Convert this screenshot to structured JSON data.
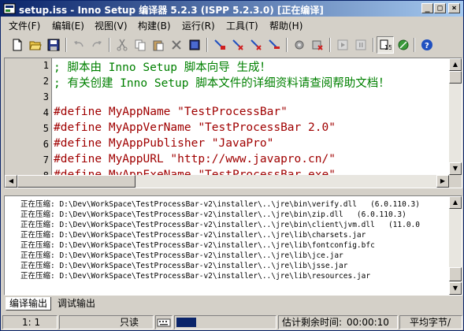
{
  "window": {
    "title": "setup.iss - Inno Setup 编译器 5.2.3 (ISPP 5.2.3.0) [正在编译]",
    "controls": [
      "_",
      "□",
      "×"
    ]
  },
  "menu": [
    {
      "label": "文件(F)"
    },
    {
      "label": "编辑(E)"
    },
    {
      "label": "视图(V)"
    },
    {
      "label": "构建(B)"
    },
    {
      "label": "运行(R)"
    },
    {
      "label": "工具(T)"
    },
    {
      "label": "帮助(H)"
    }
  ],
  "toolbar": {
    "buttons": [
      "new-icon",
      "open-icon",
      "save-icon",
      "undo-icon",
      "redo-icon",
      "cut-icon",
      "copy-icon",
      "paste-icon",
      "delete-icon",
      "select-all-icon",
      "compile-icon",
      "stop-compile-icon",
      "run-icon",
      "stop-run-icon",
      "settings-icon",
      "pause-icon",
      "stop-icon",
      "target-icon",
      "ispp-icon",
      "help-icon"
    ]
  },
  "editor": {
    "lines": [
      {
        "num": "1",
        "text": "; 脚本由 Inno Setup 脚本向导 生成！",
        "kind": "comment"
      },
      {
        "num": "2",
        "text": "; 有关创建 Inno Setup 脚本文件的详细资料请查阅帮助文档！",
        "kind": "comment"
      },
      {
        "num": "3",
        "text": "",
        "kind": "blank"
      },
      {
        "num": "4",
        "text": "#define MyAppName \"TestProcessBar\"",
        "kind": "directive"
      },
      {
        "num": "5",
        "text": "#define MyAppVerName \"TestProcessBar 2.0\"",
        "kind": "directive"
      },
      {
        "num": "6",
        "text": "#define MyAppPublisher \"JavaPro\"",
        "kind": "directive"
      },
      {
        "num": "7",
        "text": "#define MyAppURL \"http://www.javapro.cn/\"",
        "kind": "directive"
      },
      {
        "num": "8",
        "text": "#define MyAppExeName \"TestProcessBar.exe\"",
        "kind": "directive"
      }
    ]
  },
  "output": {
    "lines": [
      "正在压缩: D:\\Dev\\WorkSpace\\TestProcessBar-v2\\installer\\..\\jre\\bin\\verify.dll   (6.0.110.3)",
      "正在压缩: D:\\Dev\\WorkSpace\\TestProcessBar-v2\\installer\\..\\jre\\bin\\zip.dll   (6.0.110.3)",
      "正在压缩: D:\\Dev\\WorkSpace\\TestProcessBar-v2\\installer\\..\\jre\\bin\\client\\jvm.dll   (11.0.0",
      "正在压缩: D:\\Dev\\WorkSpace\\TestProcessBar-v2\\installer\\..\\jre\\lib\\charsets.jar",
      "正在压缩: D:\\Dev\\WorkSpace\\TestProcessBar-v2\\installer\\..\\jre\\lib\\fontconfig.bfc",
      "正在压缩: D:\\Dev\\WorkSpace\\TestProcessBar-v2\\installer\\..\\jre\\lib\\jce.jar",
      "正在压缩: D:\\Dev\\WorkSpace\\TestProcessBar-v2\\installer\\..\\jre\\lib\\jsse.jar",
      "正在压缩: D:\\Dev\\WorkSpace\\TestProcessBar-v2\\installer\\..\\jre\\lib\\resources.jar"
    ]
  },
  "tabs": [
    {
      "label": "编译输出",
      "active": true
    },
    {
      "label": "调试输出",
      "active": false
    }
  ],
  "status": {
    "position": "1:   1",
    "mode": "只读",
    "progress_fraction": 0.2,
    "remaining_label": "估计剩余时间:",
    "remaining_value": "00:00:10",
    "avg_label": "平均字节/"
  },
  "colors": {
    "title_bar_start": "#0a246a",
    "title_bar_end": "#a6caf0",
    "comment": "#008000",
    "directive": "#a00000",
    "progress": "#0a246a"
  }
}
